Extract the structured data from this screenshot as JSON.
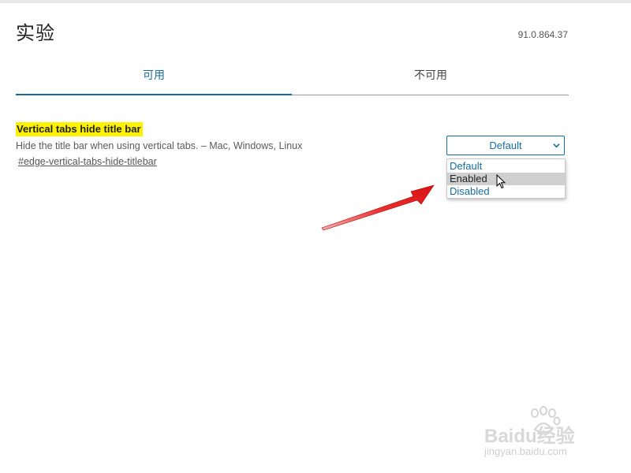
{
  "header": {
    "title": "实验",
    "version": "91.0.864.37"
  },
  "tabs": [
    {
      "label": "可用",
      "active": true
    },
    {
      "label": "不可用",
      "active": false
    }
  ],
  "flag": {
    "name": "Vertical tabs hide title bar",
    "description": "Hide the title bar when using vertical tabs. – Mac, Windows, Linux",
    "link": "#edge-vertical-tabs-hide-titlebar",
    "select_value": "Default",
    "options": [
      "Default",
      "Enabled",
      "Disabled"
    ],
    "hovered_option": "Enabled"
  },
  "watermark": {
    "logo": "Baidu经验",
    "url": "jingyan.baidu.com"
  },
  "colors": {
    "accent": "#1b6c9e",
    "highlight": "#fff200",
    "arrow": "#e02020"
  },
  "icons": {
    "select_chevron": "chevron-down-icon",
    "pointer": "mouse-cursor-icon",
    "annotation": "red-arrow-icon"
  }
}
